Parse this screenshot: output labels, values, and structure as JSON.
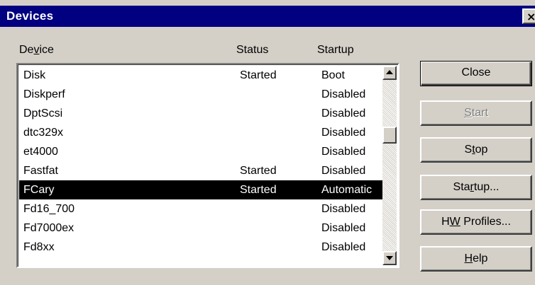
{
  "window": {
    "title": "Devices",
    "close_glyph": "×"
  },
  "columns": {
    "device_pre": "De",
    "device_u": "v",
    "device_post": "ice",
    "status": "Status",
    "startup": "Startup"
  },
  "devices": [
    {
      "name": "Disk",
      "status": "Started",
      "startup": "Boot",
      "selected": false
    },
    {
      "name": "Diskperf",
      "status": "",
      "startup": "Disabled",
      "selected": false
    },
    {
      "name": "DptScsi",
      "status": "",
      "startup": "Disabled",
      "selected": false
    },
    {
      "name": "dtc329x",
      "status": "",
      "startup": "Disabled",
      "selected": false
    },
    {
      "name": "et4000",
      "status": "",
      "startup": "Disabled",
      "selected": false
    },
    {
      "name": "Fastfat",
      "status": "Started",
      "startup": "Disabled",
      "selected": false
    },
    {
      "name": "FCary",
      "status": "Started",
      "startup": "Automatic",
      "selected": true
    },
    {
      "name": "Fd16_700",
      "status": "",
      "startup": "Disabled",
      "selected": false
    },
    {
      "name": "Fd7000ex",
      "status": "",
      "startup": "Disabled",
      "selected": false
    },
    {
      "name": "Fd8xx",
      "status": "",
      "startup": "Disabled",
      "selected": false
    }
  ],
  "buttons": {
    "close": {
      "pre": "Close",
      "u": "",
      "post": ""
    },
    "start": {
      "pre": "",
      "u": "S",
      "post": "tart"
    },
    "stop": {
      "pre": "S",
      "u": "t",
      "post": "op"
    },
    "startup": {
      "pre": "Sta",
      "u": "r",
      "post": "tup..."
    },
    "hw_profiles": {
      "pre": "H",
      "u": "W",
      "post": " Profiles..."
    },
    "help": {
      "pre": "",
      "u": "H",
      "post": "elp"
    }
  },
  "icons": {
    "scroll_up": "arrow-up-icon",
    "scroll_down": "arrow-down-icon"
  }
}
